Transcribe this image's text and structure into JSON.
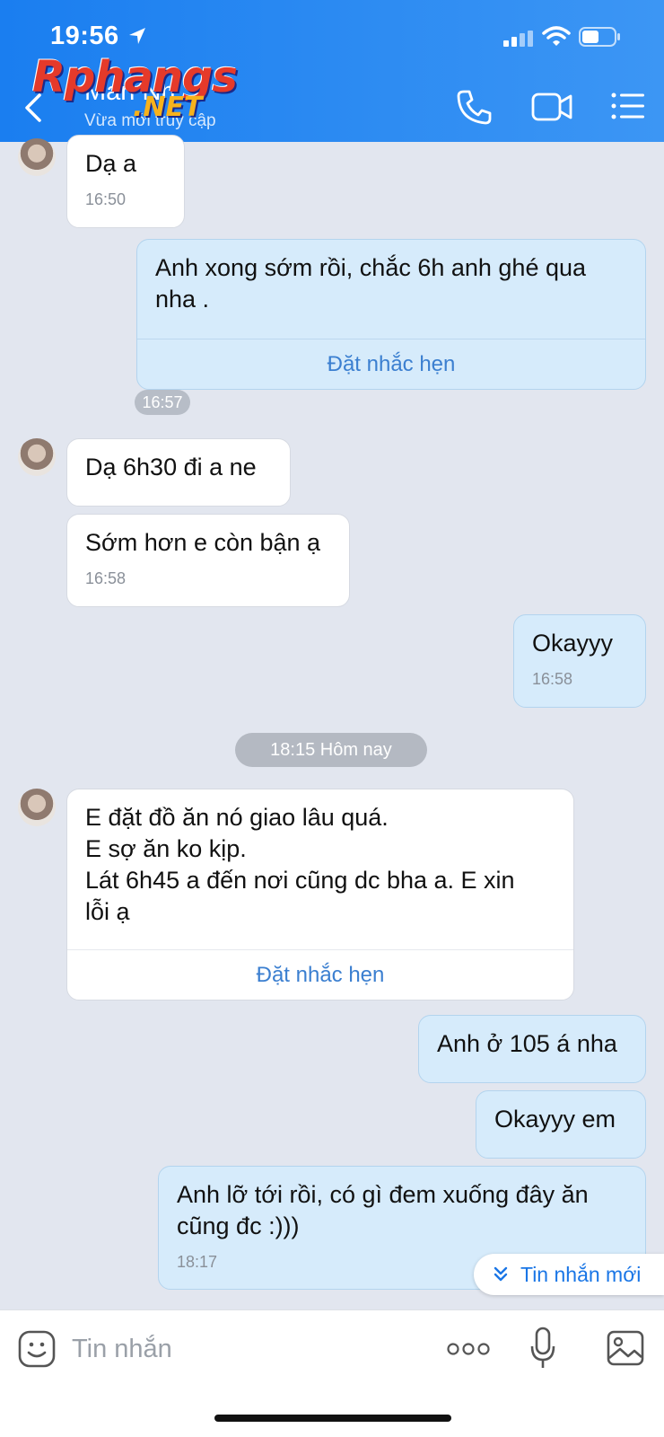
{
  "status_bar": {
    "time": "19:56"
  },
  "header": {
    "contact_name": "Man Nh",
    "contact_status": "Vừa mới truy cập",
    "watermark_main": "Rphangs",
    "watermark_suffix": ".NET",
    "icons": [
      "back-icon",
      "phone-icon",
      "video-camera-icon",
      "list-menu-icon"
    ]
  },
  "messages": [
    {
      "direction": "in",
      "text": "Dạ a",
      "time": "16:50"
    },
    {
      "direction": "out",
      "text": "Anh xong sớm rồi, chắc 6h anh ghé qua\nnha .",
      "action": "Đặt nhắc hẹn"
    },
    {
      "direction": "out",
      "time_chip": "16:57"
    },
    {
      "direction": "in",
      "text": "Dạ 6h30 đi a ne"
    },
    {
      "direction": "in",
      "text": "Sớm hơn e còn bận ạ",
      "time": "16:58"
    },
    {
      "direction": "out",
      "text": "Okayyy",
      "time": "16:58"
    },
    {
      "date_divider": "18:15 Hôm nay"
    },
    {
      "direction": "in",
      "text": "E đặt đồ ăn nó giao lâu quá.\nE sợ ăn ko kịp.\nLát 6h45 a đến nơi cũng dc bha a. E xin\nlỗi ạ",
      "action": "Đặt nhắc hẹn"
    },
    {
      "direction": "out",
      "text": "Anh ở 105 á nha"
    },
    {
      "direction": "out",
      "text": "Okayyy em"
    },
    {
      "direction": "out",
      "text": "Anh lỡ tới rồi, có gì đem xuống đây ăn\ncũng đc :)))",
      "time": "18:17"
    }
  ],
  "new_message_button": "Tin nhắn mới",
  "input_bar": {
    "placeholder": "Tin nhắn",
    "icons": [
      "emoji-icon",
      "more-dots-icon",
      "microphone-icon",
      "image-icon"
    ]
  },
  "colors": {
    "header": "#1a7ef0",
    "incoming_bubble": "#ffffff",
    "outgoing_bubble": "#d6ebfb",
    "chat_background": "#e2e6ef",
    "link": "#3b7fd0"
  }
}
